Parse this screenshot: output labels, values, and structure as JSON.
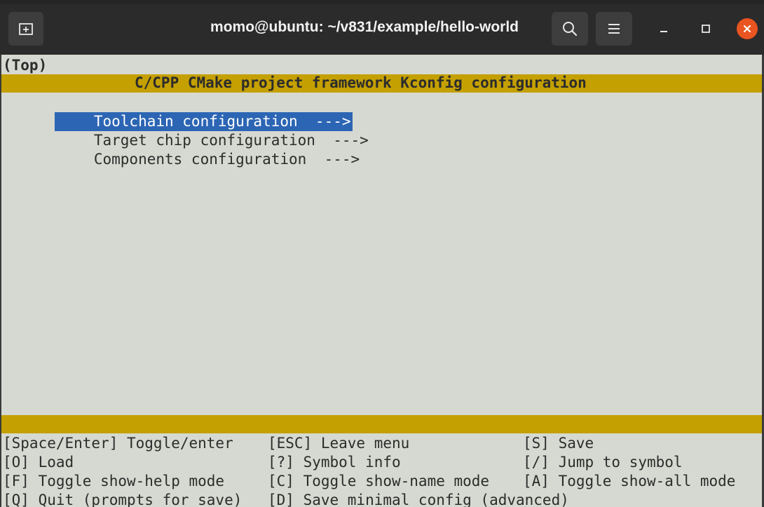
{
  "window": {
    "title": "momo@ubuntu: ~/v831/example/hello-world",
    "icons": {
      "new_tab": "new-tab-icon",
      "search": "search-icon",
      "menu": "hamburger-menu-icon",
      "minimize": "minimize-icon",
      "maximize": "maximize-icon",
      "close": "close-icon"
    },
    "colors": {
      "titlebar": "#2b2b2b",
      "close": "#e95420"
    }
  },
  "terminal": {
    "breadcrumb": "(Top)",
    "header_title": "C/CPP CMake project framework Kconfig configuration",
    "menu_items": [
      {
        "label": "Toolchain configuration  --->",
        "selected": true
      },
      {
        "label": "Target chip configuration  --->",
        "selected": false
      },
      {
        "label": "Components configuration  --->",
        "selected": false
      }
    ],
    "help": [
      [
        "[Space/Enter] Toggle/enter",
        "[ESC] Leave menu",
        "[S] Save"
      ],
      [
        "[O] Load",
        "[?] Symbol info",
        "[/] Jump to symbol"
      ],
      [
        "[F] Toggle show-help mode",
        "[C] Toggle show-name mode",
        "[A] Toggle show-all mode"
      ],
      [
        "[Q] Quit (prompts for save)",
        "[D] Save minimal config (advanced)",
        ""
      ]
    ],
    "colors": {
      "background": "#d6d9d1",
      "bar": "#c4a000",
      "selection": "#2c65b4"
    }
  }
}
